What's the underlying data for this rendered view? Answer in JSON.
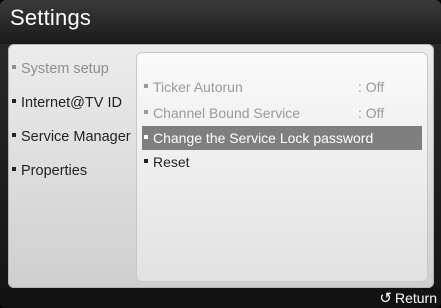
{
  "header": {
    "title": "Settings"
  },
  "sidebar": {
    "items": [
      {
        "label": "System setup",
        "dim": true
      },
      {
        "label": "Internet@TV ID",
        "dim": false
      },
      {
        "label": "Service Manager",
        "dim": false
      },
      {
        "label": "Properties",
        "dim": false
      }
    ]
  },
  "options": {
    "items": [
      {
        "label": "Ticker Autorun",
        "value": ": Off",
        "dim": true,
        "selected": false
      },
      {
        "label": "Channel Bound Service",
        "value": ": Off",
        "dim": true,
        "selected": false
      },
      {
        "label": "Change the Service Lock password",
        "value": "",
        "dim": false,
        "selected": true
      },
      {
        "label": "Reset",
        "value": "",
        "dim": false,
        "selected": false
      }
    ]
  },
  "footer": {
    "return_label": "Return",
    "return_icon": "return-arrow-icon"
  },
  "colors": {
    "selected_background": "#7f7f7f",
    "dim_text": "#9a9a9a",
    "title_bar": "#2a2a2a"
  }
}
